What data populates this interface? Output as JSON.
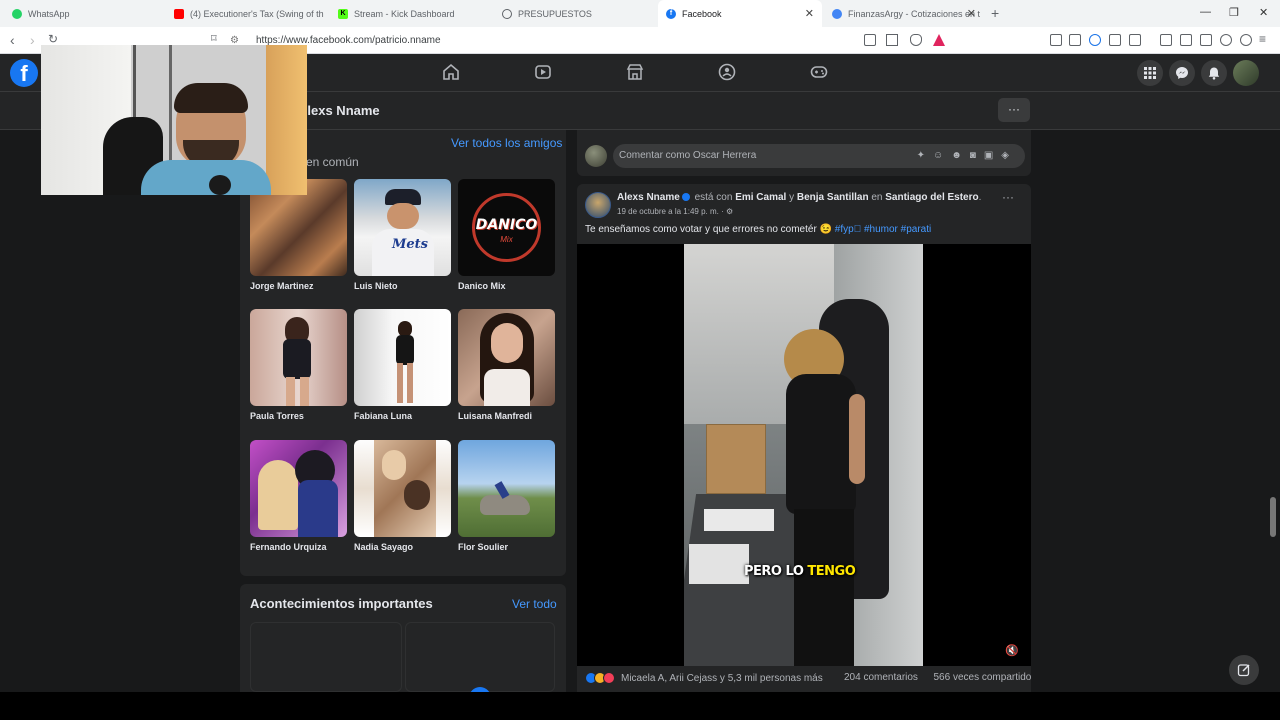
{
  "browser": {
    "tabs": [
      {
        "title": "WhatsApp",
        "icon": "whatsapp-icon",
        "color": "#25d366"
      },
      {
        "title": "(4) Executioner's Tax (Swing of th",
        "icon": "youtube-icon",
        "color": "#ff0000"
      },
      {
        "title": "Stream - Kick Dashboard",
        "icon": "kick-icon",
        "color": "#53fc18"
      },
      {
        "title": "PRESUPUESTOS",
        "icon": "globe-icon",
        "color": "#5f6368"
      },
      {
        "title": "Facebook",
        "icon": "facebook-icon",
        "color": "#1877f2",
        "active": true
      },
      {
        "title": "FinanzasArgy - Cotizaciones en t",
        "icon": "finanzas-icon",
        "color": "#4285f4"
      }
    ],
    "url": "https://www.facebook.com/patricio.nname"
  },
  "profile": {
    "name": "Alexs Nname",
    "friends_see_all": "Ver todos los amigos",
    "mutual_label": "en común",
    "friends": [
      {
        "name": "Jorge Martinez"
      },
      {
        "name": "Luis Nieto"
      },
      {
        "name": "Danico Mix"
      },
      {
        "name": "Paula Torres"
      },
      {
        "name": "Fabiana Luna"
      },
      {
        "name": "Luisana Manfredi"
      },
      {
        "name": "Fernando Urquiza"
      },
      {
        "name": "Nadia Sayago"
      },
      {
        "name": "Flor Soulier"
      }
    ],
    "events_title": "Acontecimientos importantes",
    "events_see_all": "Ver todo"
  },
  "comment_box": {
    "placeholder": "Comentar como Oscar Herrera"
  },
  "post": {
    "author": "Alexs Nname",
    "with_text": "está con",
    "tagged1": "Emi Camal",
    "and_text": "y",
    "tagged2": "Benja Santillan",
    "in_text": "en",
    "location": "Santiago del Estero",
    "date": "19 de octubre a la 1:49 p. m. ·",
    "text": "Te enseñamos como votar y que errores no cometér 😉",
    "hashtags": [
      "#fyp゚",
      "#humor",
      "#parati"
    ],
    "caption_white": "PERO LO ",
    "caption_yellow": "TENGO",
    "reactions_text": "Micaela A, Arii Cejass y 5,3 mil personas más",
    "comments": "204 comentarios",
    "shares": "566 veces compartido"
  },
  "video": {
    "muted": true
  },
  "colors": {
    "facebook_blue": "#1877f2",
    "link": "#4599ff",
    "surface": "#242526",
    "background": "#18191a"
  }
}
